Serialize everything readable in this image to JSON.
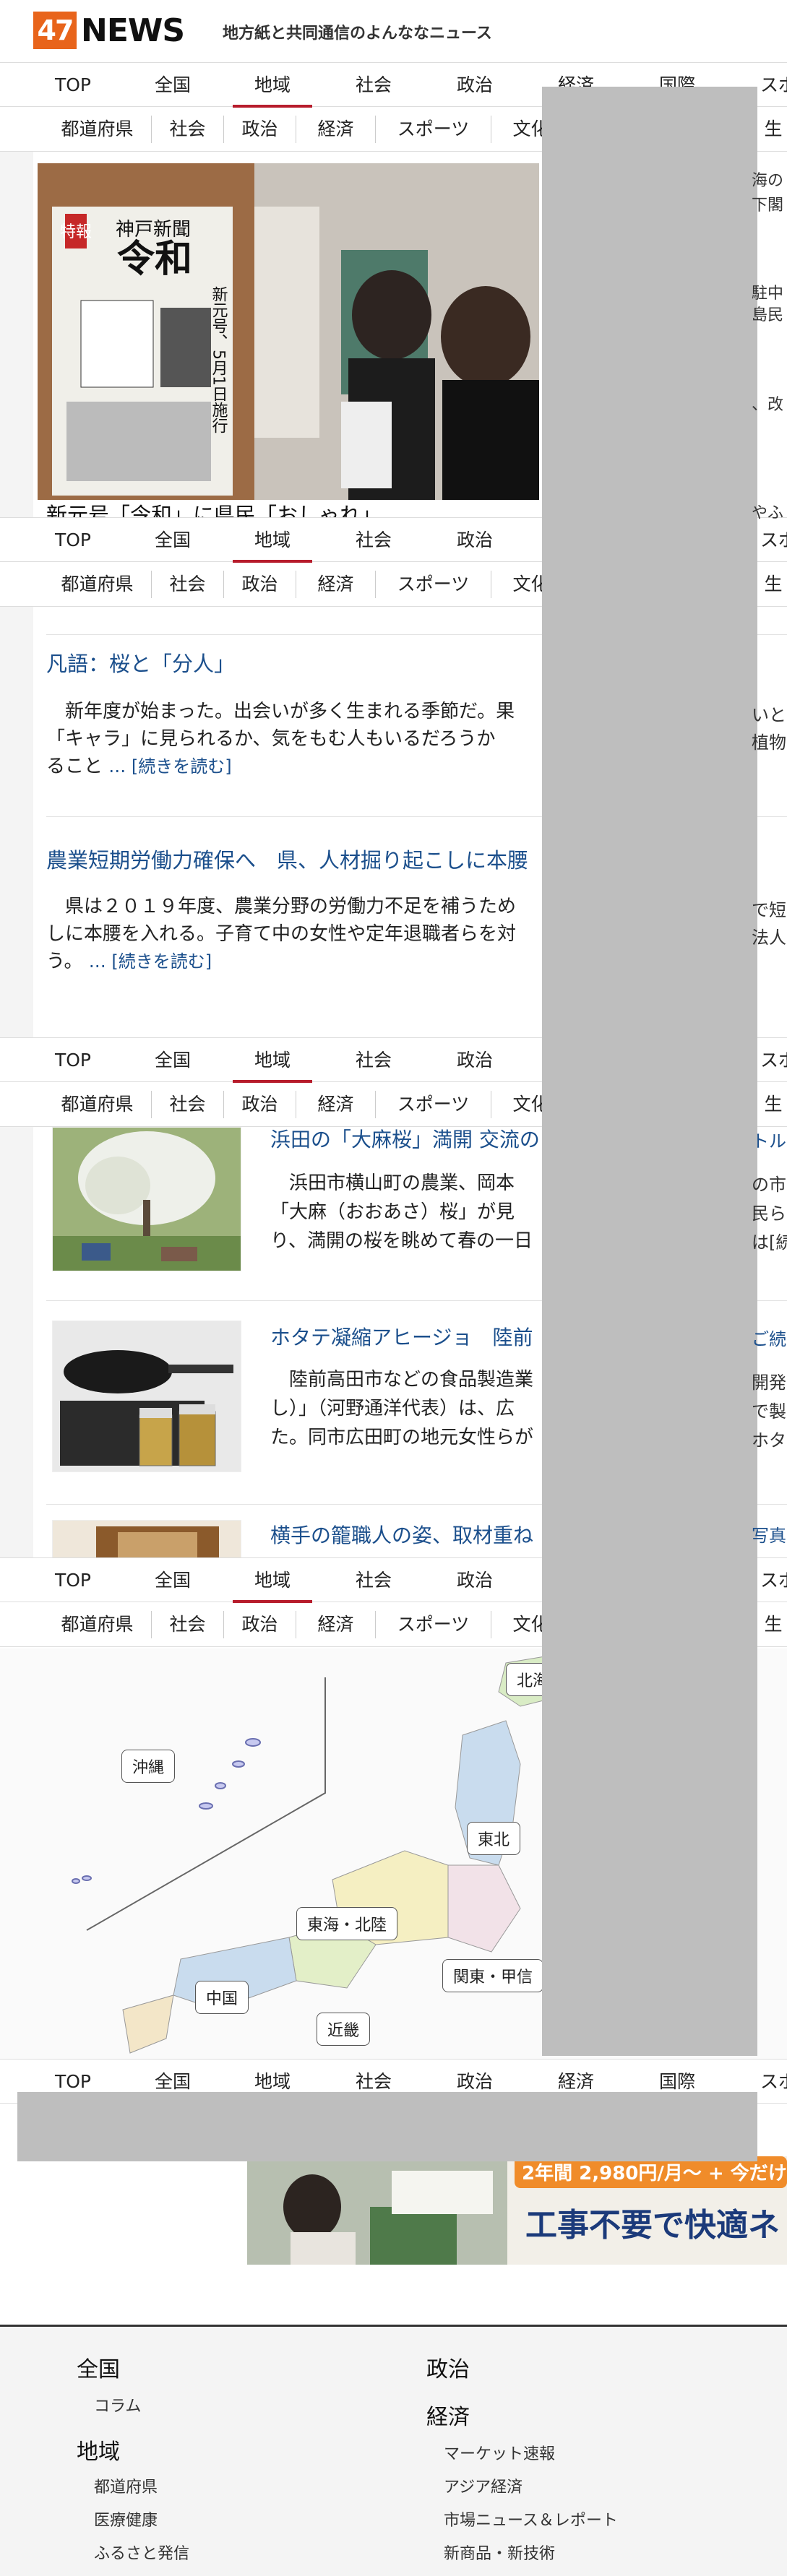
{
  "header": {
    "logo_num": "47",
    "logo_word": "NEWS",
    "tagline": "地方紙と共同通信のよんななニュース"
  },
  "nav": {
    "main": [
      "TOP",
      "全国",
      "地域",
      "社会",
      "政治",
      "経済",
      "国際",
      "スポ"
    ],
    "sub": [
      "都道府県",
      "社会",
      "政治",
      "経済",
      "スポーツ",
      "文化",
      "生"
    ]
  },
  "hero": {
    "caption": "新元号「令和」に県民「おしゃれ」",
    "photo_kanji": "令和",
    "newspaper_name": "神戸新聞",
    "paper_badge": "特報",
    "paper_vertical": "新元号、5月1日施行",
    "side_snippets": [
      "海の",
      "下閣",
      "駐中",
      "島民",
      "、改",
      "やふ"
    ]
  },
  "columns": [
    {
      "title": "凡語：桜と「分人」",
      "body": "　新年度が始まった。出会いが多く生まれる季節だ。果",
      "body2": "「キャラ」に見られるか、気をもむ人もいるだろうか",
      "body3": "ること",
      "more": "… [続きを読む]",
      "right_fragment": "いと",
      "right_fragment2": "植物"
    },
    {
      "title": "農業短期労働力確保へ　県、人材掘り起こしに本腰",
      "body": "　県は２０１９年度、農業分野の労働力不足を補うため",
      "body2": "しに本腰を入れる。子育て中の女性や定年退職者らを対",
      "body3": "う。",
      "more": "… [続きを読む]",
      "right_fragment": "で短",
      "right_fragment2": "法人"
    }
  ],
  "local_news": [
    {
      "title": "浜田の「大麻桜」満開 交流の",
      "body": "　浜田市横山町の農業、岡本",
      "body2": "「大麻（おおあさ）桜」が見",
      "body3": "り、満開の桜を眺めて春の一日",
      "right_fragment": "トル",
      "right_fragment2": "の市",
      "right_fragment3": "民ら",
      "right_fragment4": "は[続"
    },
    {
      "title": "ホタテ凝縮アヒージョ　陸前",
      "body": "　陸前高田市などの食品製造業",
      "body2": "し）」（河野通洋代表）は、広",
      "body3": "た。同市広田町の地元女性らが",
      "right_fragment": "ご続",
      "right_fragment2": "開発",
      "right_fragment3": "で製",
      "right_fragment4": "ホタ"
    },
    {
      "title": "横手の籠職人の姿、取材重ね",
      "right_fragment": "写真"
    }
  ],
  "map": {
    "regions": [
      "沖縄",
      "北海道",
      "東北",
      "東海・北陸",
      "関東・甲信",
      "中国",
      "近畿"
    ]
  },
  "ad": {
    "headline": "工事不要で快適ネ",
    "price": "2年間 2,980円/月～ + 今だけ"
  },
  "footer": {
    "col1": {
      "head1": "全国",
      "links1": [
        "コラム"
      ],
      "head2": "地域",
      "links2": [
        "都道府県",
        "医療健康",
        "ふるさと発信"
      ]
    },
    "col2": {
      "head1": "政治",
      "head2": "経済",
      "links2": [
        "マーケット速報",
        "アジア経済",
        "市場ニュース＆レポート",
        "新商品・新技術"
      ]
    }
  },
  "colors": {
    "brand": "#e8641b",
    "accent": "#b71c2c",
    "link": "#1b4f8c",
    "overlay": "#bebebe"
  }
}
